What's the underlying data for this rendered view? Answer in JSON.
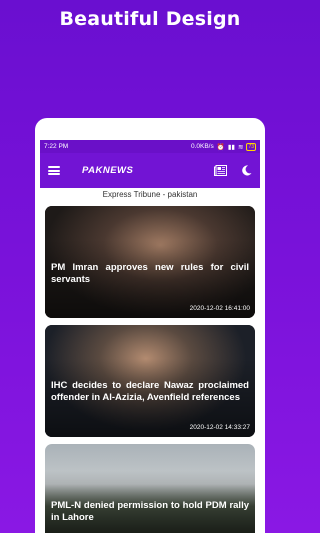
{
  "promo": {
    "title": "Beautiful Design"
  },
  "statusbar": {
    "time": "7:22 PM",
    "speed": "0.0KB/s",
    "battery": "73"
  },
  "appbar": {
    "title": "PAKNEWS"
  },
  "source": {
    "label": "Express Tribune - pakistan"
  },
  "articles": [
    {
      "headline": "PM Imran approves new rules for civil servants",
      "timestamp": "2020-12-02 16:41:00"
    },
    {
      "headline": "IHC decides to declare Nawaz proclaimed offender in Al-Azizia, Avenfield references",
      "timestamp": "2020-12-02 14:33:27"
    },
    {
      "headline": "PML-N denied permission to hold PDM rally in Lahore",
      "timestamp": ""
    }
  ],
  "colors": {
    "background": "#7a12da",
    "appbar": "#7214d4",
    "statusbar": "#6a10c8"
  },
  "icons": [
    "menu-icon",
    "news-icon",
    "moon-icon"
  ]
}
